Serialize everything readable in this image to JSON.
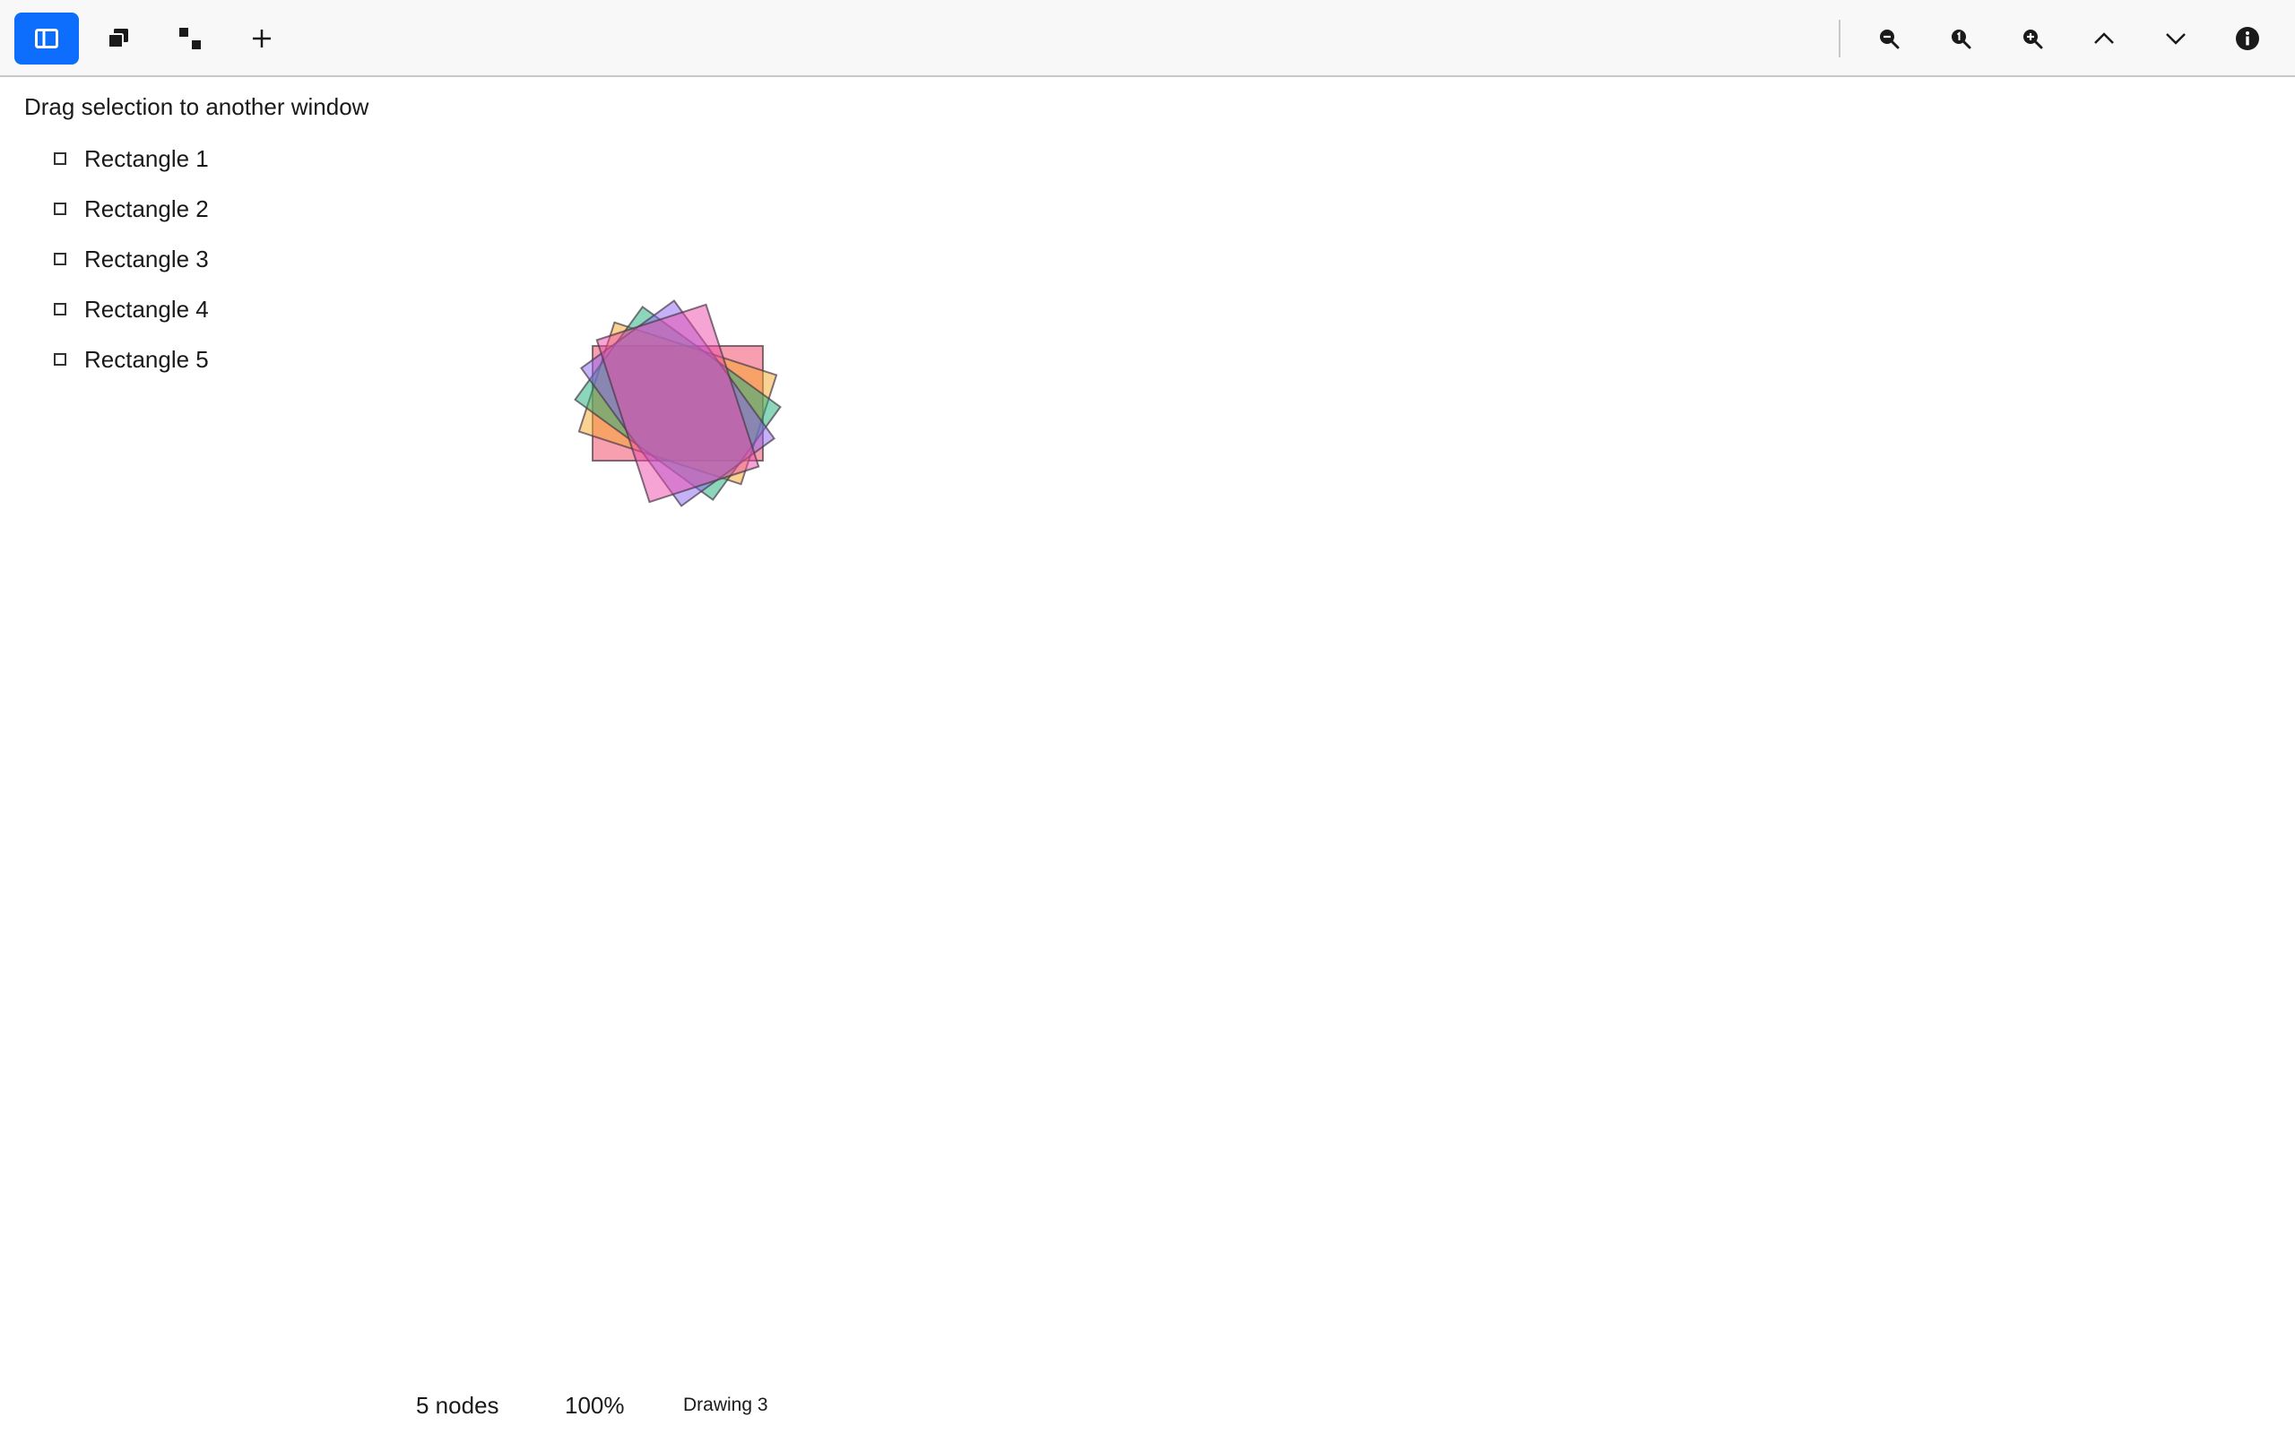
{
  "toolbar": {
    "left_buttons": [
      {
        "name": "sidebar-toggle",
        "icon": "sidebar-icon",
        "active": true
      },
      {
        "name": "layers",
        "icon": "stack-icon"
      },
      {
        "name": "arrange",
        "icon": "diagonal-squares-icon"
      },
      {
        "name": "add",
        "icon": "plus-icon"
      }
    ],
    "right_buttons": [
      {
        "name": "zoom-out",
        "icon": "zoom-out-icon"
      },
      {
        "name": "zoom-reset",
        "icon": "zoom-reset-icon"
      },
      {
        "name": "zoom-in",
        "icon": "zoom-in-icon"
      },
      {
        "name": "move-up",
        "icon": "chevron-up-icon"
      },
      {
        "name": "move-down",
        "icon": "chevron-down-icon"
      },
      {
        "name": "info",
        "icon": "info-icon"
      }
    ],
    "accent_color": "#0d6efd"
  },
  "sidebar": {
    "hint": "Drag selection to another window",
    "items": [
      {
        "label": "Rectangle 1"
      },
      {
        "label": "Rectangle 2"
      },
      {
        "label": "Rectangle 3"
      },
      {
        "label": "Rectangle 4"
      },
      {
        "label": "Rectangle 5"
      }
    ]
  },
  "canvas": {
    "shapes": [
      {
        "name": "Rectangle 1",
        "color": "#f0405f",
        "rotation_deg": 0
      },
      {
        "name": "Rectangle 2",
        "color": "#f5a623",
        "rotation_deg": 18
      },
      {
        "name": "Rectangle 3",
        "color": "#19b07a",
        "rotation_deg": 36
      },
      {
        "name": "Rectangle 4",
        "color": "#8a63f2",
        "rotation_deg": 54
      },
      {
        "name": "Rectangle 5",
        "color": "#ee4aa8",
        "rotation_deg": 72
      }
    ]
  },
  "status": {
    "nodes": "5 nodes",
    "zoom": "100%",
    "document": "Drawing 3"
  }
}
